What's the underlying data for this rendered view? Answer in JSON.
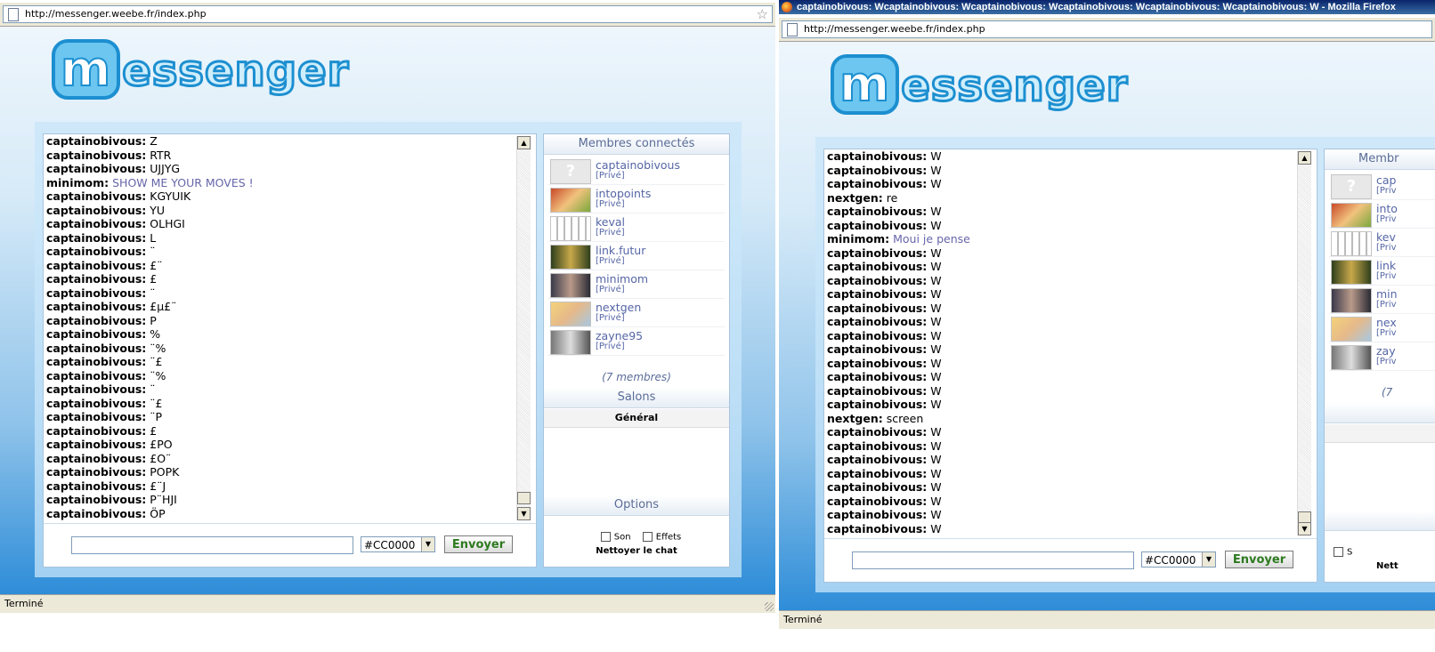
{
  "browser": {
    "url": "http://messenger.weebe.fr/index.php",
    "window_title_b": "captainobivous: Wcaptainobivous: Wcaptainobivous: Wcaptainobivous: Wcaptainobivous: Wcaptainobivous: W - Mozilla Firefox",
    "status": "Terminé"
  },
  "logo": {
    "first": "m",
    "rest": "essenger"
  },
  "chat_a": {
    "messages": [
      {
        "nick": "captainobivous:",
        "text": "Z"
      },
      {
        "nick": "captainobivous:",
        "text": "RTR"
      },
      {
        "nick": "captainobivous:",
        "text": "UJJYG"
      },
      {
        "nick": "minimom:",
        "text": "SHOW ME YOUR MOVES !"
      },
      {
        "nick": "captainobivous:",
        "text": "KGYUIK"
      },
      {
        "nick": "captainobivous:",
        "text": "YU"
      },
      {
        "nick": "captainobivous:",
        "text": "OLHGI"
      },
      {
        "nick": "captainobivous:",
        "text": "L"
      },
      {
        "nick": "captainobivous:",
        "text": "¨"
      },
      {
        "nick": "captainobivous:",
        "text": "£¨"
      },
      {
        "nick": "captainobivous:",
        "text": "£"
      },
      {
        "nick": "captainobivous:",
        "text": "¨"
      },
      {
        "nick": "captainobivous:",
        "text": "£µ£¨"
      },
      {
        "nick": "captainobivous:",
        "text": "P"
      },
      {
        "nick": "captainobivous:",
        "text": "%"
      },
      {
        "nick": "captainobivous:",
        "text": "¨%"
      },
      {
        "nick": "captainobivous:",
        "text": "¨£"
      },
      {
        "nick": "captainobivous:",
        "text": "¨%"
      },
      {
        "nick": "captainobivous:",
        "text": "¨"
      },
      {
        "nick": "captainobivous:",
        "text": "¨£"
      },
      {
        "nick": "captainobivous:",
        "text": "¨P"
      },
      {
        "nick": "captainobivous:",
        "text": "£"
      },
      {
        "nick": "captainobivous:",
        "text": "£PO"
      },
      {
        "nick": "captainobivous:",
        "text": "£O¨"
      },
      {
        "nick": "captainobivous:",
        "text": "POPK"
      },
      {
        "nick": "captainobivous:",
        "text": "£¨J"
      },
      {
        "nick": "captainobivous:",
        "text": "P¨HJI"
      },
      {
        "nick": "captainobivous:",
        "text": "ÖP"
      }
    ]
  },
  "chat_b": {
    "messages": [
      {
        "nick": "captainobivous:",
        "text": "W"
      },
      {
        "nick": "captainobivous:",
        "text": "W"
      },
      {
        "nick": "captainobivous:",
        "text": "W"
      },
      {
        "nick": "nextgen:",
        "text": "re"
      },
      {
        "nick": "captainobivous:",
        "text": "W"
      },
      {
        "nick": "captainobivous:",
        "text": "W"
      },
      {
        "nick": "minimom:",
        "text": "Moui je pense"
      },
      {
        "nick": "captainobivous:",
        "text": "W"
      },
      {
        "nick": "captainobivous:",
        "text": "W"
      },
      {
        "nick": "captainobivous:",
        "text": "W"
      },
      {
        "nick": "captainobivous:",
        "text": "W"
      },
      {
        "nick": "captainobivous:",
        "text": "W"
      },
      {
        "nick": "captainobivous:",
        "text": "W"
      },
      {
        "nick": "captainobivous:",
        "text": "W"
      },
      {
        "nick": "captainobivous:",
        "text": "W"
      },
      {
        "nick": "captainobivous:",
        "text": "W"
      },
      {
        "nick": "captainobivous:",
        "text": "W"
      },
      {
        "nick": "captainobivous:",
        "text": "W"
      },
      {
        "nick": "captainobivous:",
        "text": "W"
      },
      {
        "nick": "nextgen:",
        "text": "screen"
      },
      {
        "nick": "captainobivous:",
        "text": "W"
      },
      {
        "nick": "captainobivous:",
        "text": "W"
      },
      {
        "nick": "captainobivous:",
        "text": "W"
      },
      {
        "nick": "captainobivous:",
        "text": "W"
      },
      {
        "nick": "captainobivous:",
        "text": "W"
      },
      {
        "nick": "captainobivous:",
        "text": "W"
      },
      {
        "nick": "captainobivous:",
        "text": "W"
      },
      {
        "nick": "captainobivous:",
        "text": "W"
      }
    ]
  },
  "composer": {
    "input_value": "",
    "color_value": "#CC0000",
    "send_label": "Envoyer"
  },
  "sidebar": {
    "members_title": "Membres connectés",
    "members": [
      {
        "name": "captainobivous",
        "priv": "[Privé]",
        "avatar": "unknown"
      },
      {
        "name": "intopoints",
        "priv": "[Privé]",
        "avatar": "red-hair"
      },
      {
        "name": "keval",
        "priv": "[Privé]",
        "avatar": "manga"
      },
      {
        "name": "link.futur",
        "priv": "[Privé]",
        "avatar": "elf"
      },
      {
        "name": "minimom",
        "priv": "[Privé]",
        "avatar": "dark"
      },
      {
        "name": "nextgen",
        "priv": "[Privé]",
        "avatar": "blonde"
      },
      {
        "name": "zayne95",
        "priv": "[Privé]",
        "avatar": "grey"
      }
    ],
    "member_count": "(7 membres)",
    "salons_title": "Salons",
    "salon_active": "Général",
    "options_title": "Options",
    "option_son": "Son",
    "option_effets": "Effets",
    "clean_label": "Nettoyer le chat"
  },
  "sidebar_b_partial": {
    "members": [
      {
        "name": "cap",
        "priv": "[Priv"
      },
      {
        "name": "into",
        "priv": "[Priv"
      },
      {
        "name": "kev",
        "priv": "[Priv"
      },
      {
        "name": "link",
        "priv": "[Priv"
      },
      {
        "name": "min",
        "priv": "[Priv"
      },
      {
        "name": "nex",
        "priv": "[Priv"
      },
      {
        "name": "zay",
        "priv": "[Priv"
      }
    ],
    "members_title": "Membr",
    "member_count": "(7",
    "option_s": "S",
    "clean": "Nett"
  }
}
